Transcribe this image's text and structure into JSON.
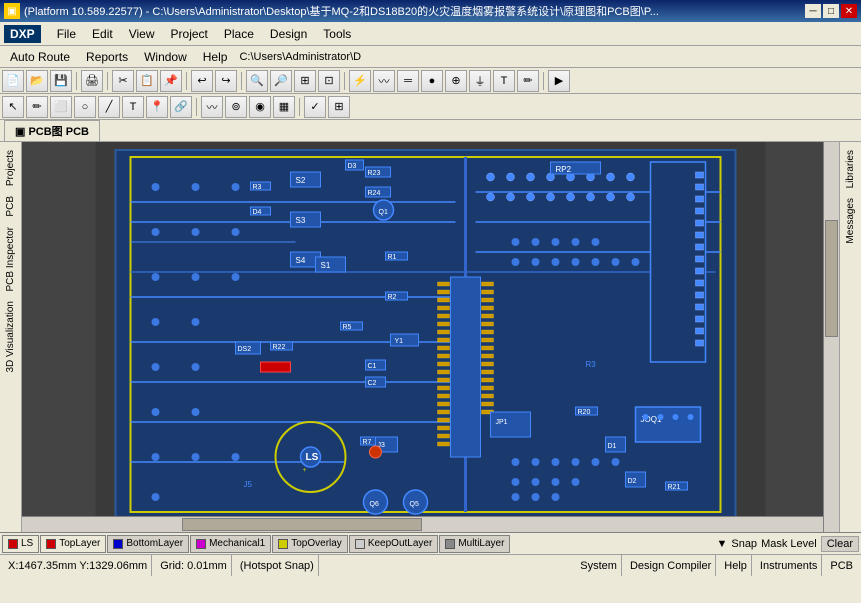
{
  "title_bar": {
    "text": "(Platform 10.589.22577) - C:\\Users\\Administrator\\Desktop\\基于MQ-2和DS18B20的火灾温度烟雾报警系统设计\\原理图和PCB图\\P...",
    "min_btn": "─",
    "max_btn": "□",
    "close_btn": "✕"
  },
  "menu_bar": {
    "items": [
      "File",
      "Edit",
      "View",
      "Project",
      "Place",
      "Design",
      "Tools"
    ]
  },
  "dxp_bar": {
    "logo": "DXP",
    "items": [
      "Auto Route",
      "Reports",
      "Window",
      "Help"
    ],
    "path": "C:\\Users\\Administrator\\D"
  },
  "toolbar1": {
    "buttons": [
      "📂",
      "💾",
      "🖨",
      "✂",
      "📋",
      "↩",
      "↪",
      "🔍",
      "🔍",
      "🔍",
      "🔍"
    ]
  },
  "toolbar2": {
    "buttons": [
      "↖",
      "✏",
      "⬜",
      "○",
      "╱",
      "T",
      "📌",
      "🔗"
    ]
  },
  "tab_bar": {
    "tabs": [
      {
        "label": "PCB图 PCB",
        "active": true
      }
    ]
  },
  "layer_tabs": {
    "layers": [
      {
        "name": "LS",
        "color": "#cc0000",
        "active": false
      },
      {
        "name": "TopLayer",
        "color": "#cc0000",
        "active": true
      },
      {
        "name": "BottomLayer",
        "color": "#0000cc",
        "active": false
      },
      {
        "name": "Mechanical1",
        "color": "#cc00cc",
        "active": false
      },
      {
        "name": "TopOverlay",
        "color": "#cccc00",
        "active": false
      },
      {
        "name": "KeepOutLayer",
        "color": "#cccccc",
        "active": false
      },
      {
        "name": "MultiLayer",
        "color": "#888888",
        "active": false
      }
    ],
    "snap_label": "Snap",
    "mask_level_label": "Mask Level",
    "clear_label": "Clear"
  },
  "status_bar": {
    "coords": "X:1467.35mm Y:1329.06mm",
    "grid": "Grid: 0.01mm",
    "hotspot": "(Hotspot Snap)",
    "system": "System",
    "design_compiler": "Design Compiler",
    "help": "Help",
    "instruments": "Instruments",
    "pcb": "PCB"
  },
  "left_sidebar": {
    "items": [
      "Projects",
      "PCB",
      "PCB Inspector",
      "3D Visualization"
    ]
  },
  "right_sidebar": {
    "items": [
      "Libraries",
      "Messages"
    ]
  }
}
